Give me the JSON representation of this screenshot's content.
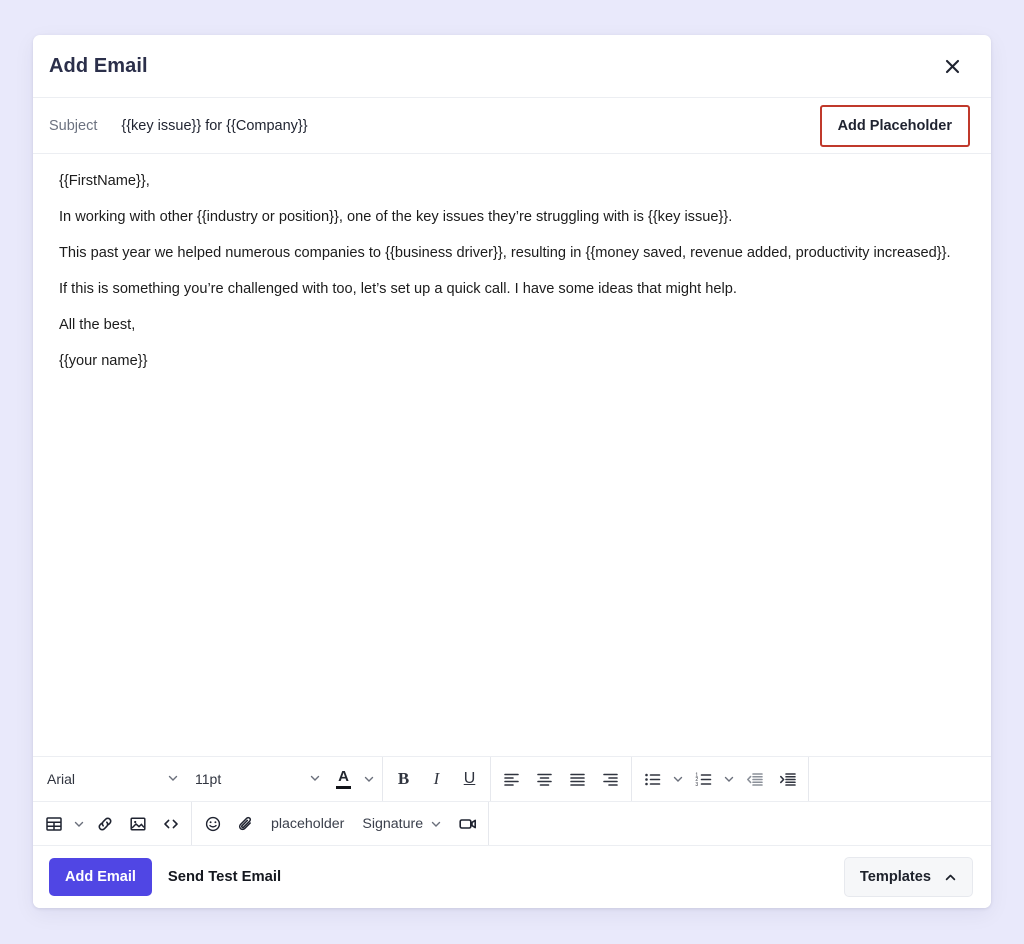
{
  "modal": {
    "title": "Add Email",
    "close_icon": "close-icon"
  },
  "subject": {
    "label": "Subject",
    "value": "{{key issue}} for {{Company}}",
    "placeholder": "Subject",
    "add_placeholder_label": "Add Placeholder",
    "add_placeholder_border_color": "#c0392b"
  },
  "body": {
    "paragraphs": [
      "{{FirstName}},",
      "In working with other {{industry or position}}, one of the key issues they’re struggling with is {{key issue}}.",
      "This past year we helped numerous companies to {{business driver}}, resulting in {{money saved, revenue added, productivity increased}}.",
      "If this is something you’re challenged with too, let’s set up a quick call. I have some ideas that might help.",
      "All the best,",
      "{{your name}}"
    ]
  },
  "toolbar_row1": {
    "font_family": "Arial",
    "font_size": "11pt",
    "text_color_icon": "text-color-icon",
    "bold": "B",
    "italic": "I",
    "underline": "U",
    "align_left": "align-left-icon",
    "align_center": "align-center-icon",
    "align_justify": "align-justify-icon",
    "align_right": "align-right-icon",
    "bullet_list": "bullet-list-icon",
    "numbered_list": "numbered-list-icon",
    "outdent": "outdent-icon",
    "indent": "indent-icon"
  },
  "toolbar_row2": {
    "table": "table-icon",
    "link": "link-icon",
    "image": "image-icon",
    "code": "<>",
    "emoji": "emoji-icon",
    "attachment": "paperclip-icon",
    "placeholder_label": "placeholder",
    "signature_label": "Signature",
    "video": "video-icon"
  },
  "footer": {
    "primary_label": "Add Email",
    "secondary_label": "Send Test Email",
    "templates_label": "Templates",
    "templates_caret": "chevron-up-icon",
    "primary_color": "#5046e4"
  },
  "theme": {
    "page_background": "#e9e9fb",
    "card_background": "#ffffff",
    "border": "#eceef2",
    "title_color": "#2b2f4a"
  }
}
